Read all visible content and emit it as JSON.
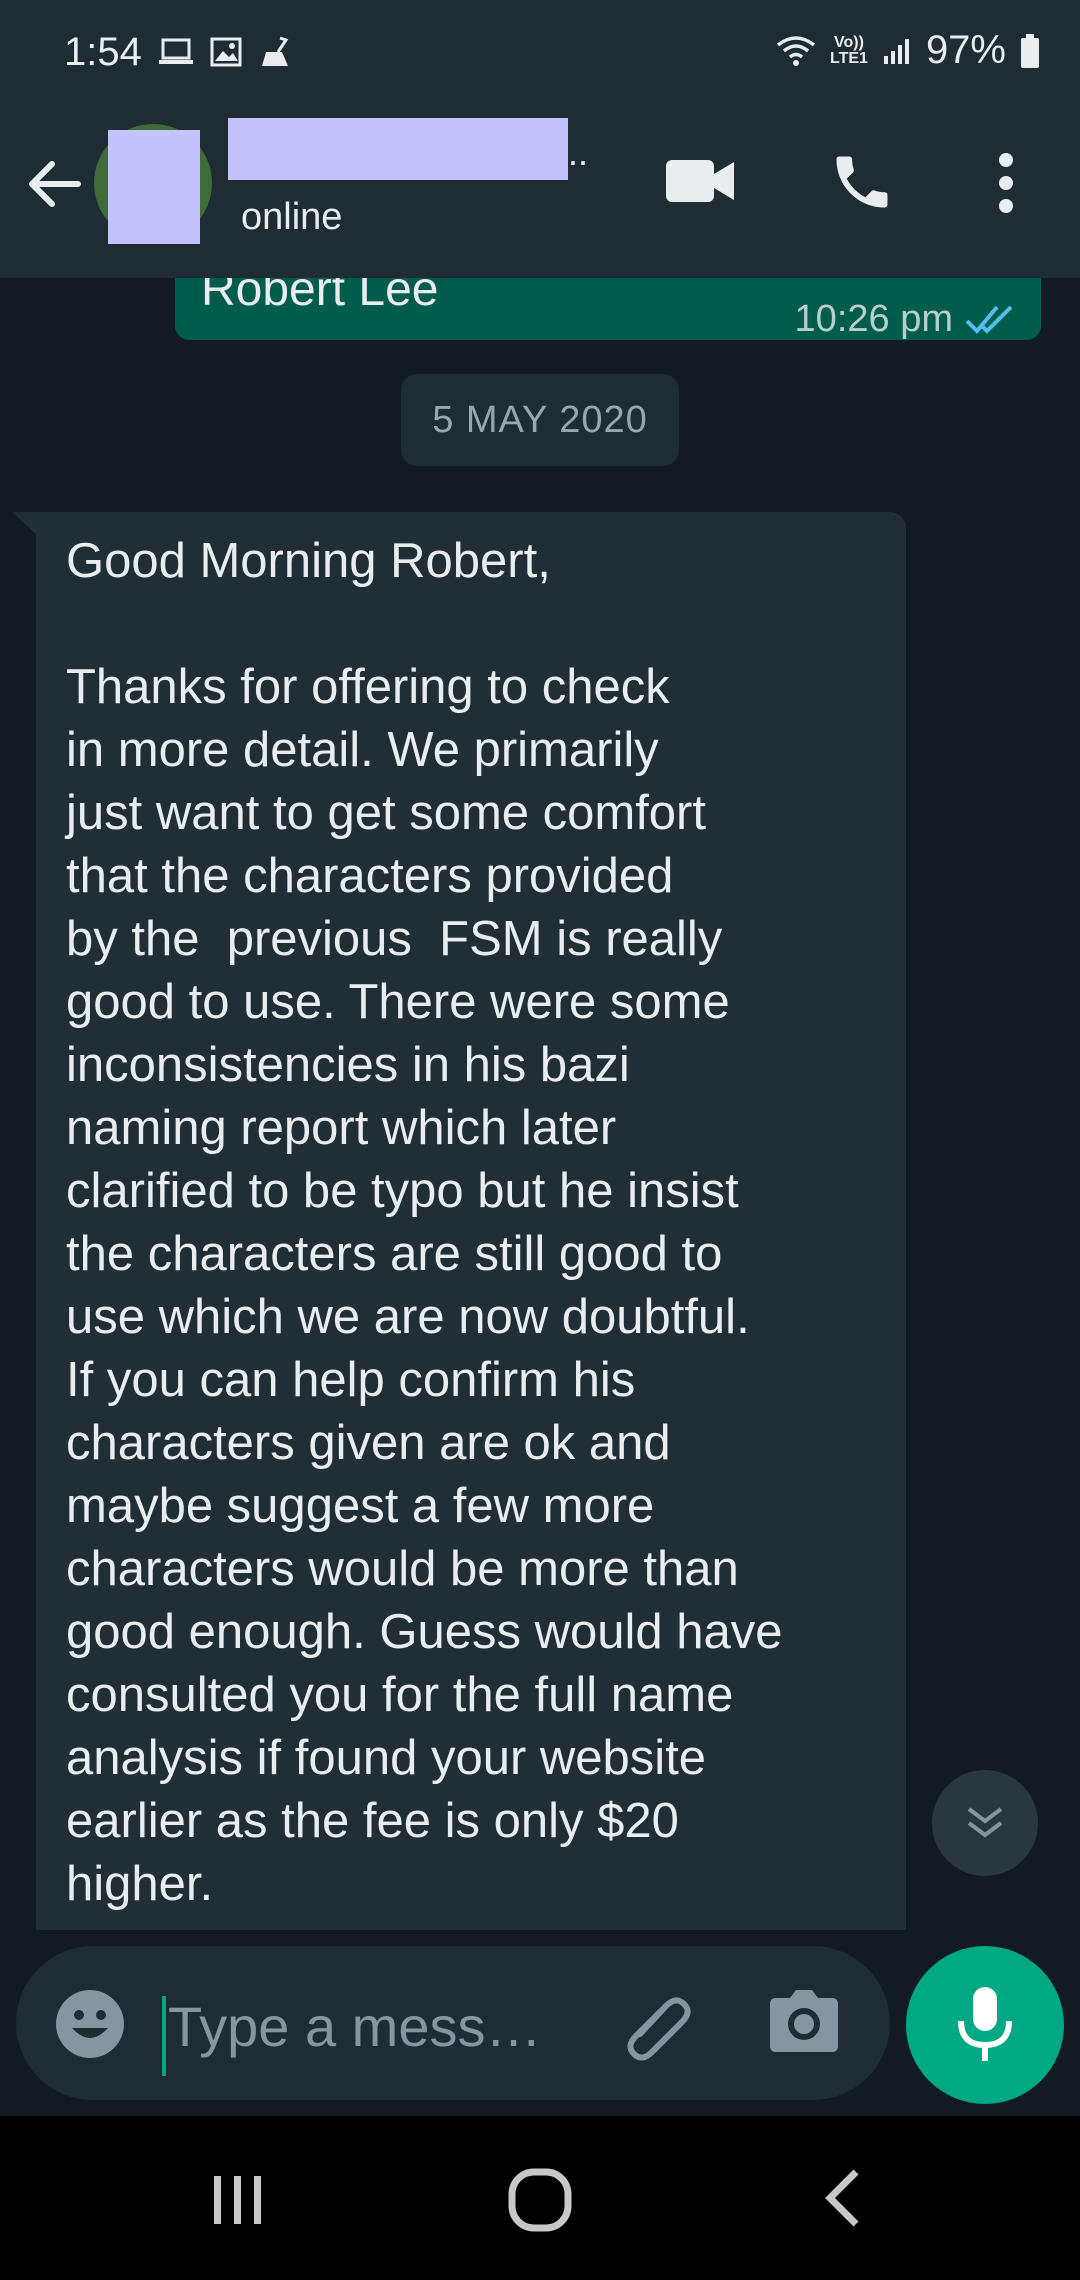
{
  "status_bar": {
    "time": "1:54",
    "network_label": "Vo))\nLTE1",
    "battery_percent": "97%",
    "icons": [
      "laptop-icon",
      "image-icon",
      "broom-icon",
      "wifi-icon",
      "signal-icon",
      "battery-icon"
    ]
  },
  "header": {
    "status": "online",
    "name_suffix": "..",
    "icons": [
      "back-arrow-icon",
      "video-call-icon",
      "voice-call-icon",
      "more-vert-icon"
    ]
  },
  "chat": {
    "outgoing_message": {
      "text": "Robert Lee",
      "time": "10:26 pm",
      "status_icon": "double-check-icon"
    },
    "date_separator": "5 MAY 2020",
    "incoming_message": {
      "text": "Good Morning Robert,\n\nThanks for offering to check\nin more detail. We primarily\njust want to get some comfort\nthat the characters provided\nby the  previous  FSM is really\ngood to use. There were some\ninconsistencies in his bazi\nnaming report which later\nclarified to be typo but he insist\nthe characters are still good to\nuse which we are now doubtful.\nIf you can help confirm his\ncharacters given are ok and\nmaybe suggest a few more\ncharacters would be more than\ngood enough. Guess would have\nconsulted you for the full name\nanalysis if found your website\nearlier as the fee is only $20\nhigher."
    }
  },
  "composer": {
    "placeholder": "Type a mess…",
    "icons": [
      "emoji-icon",
      "attach-icon",
      "camera-icon",
      "mic-icon"
    ]
  },
  "colors": {
    "background": "#121b22",
    "header": "#1f2c34",
    "outgoing_bubble": "#005c4b",
    "incoming_bubble": "#222e35",
    "accent": "#00a884",
    "read_tick": "#53bdeb",
    "redaction": "#c4c3ff"
  }
}
